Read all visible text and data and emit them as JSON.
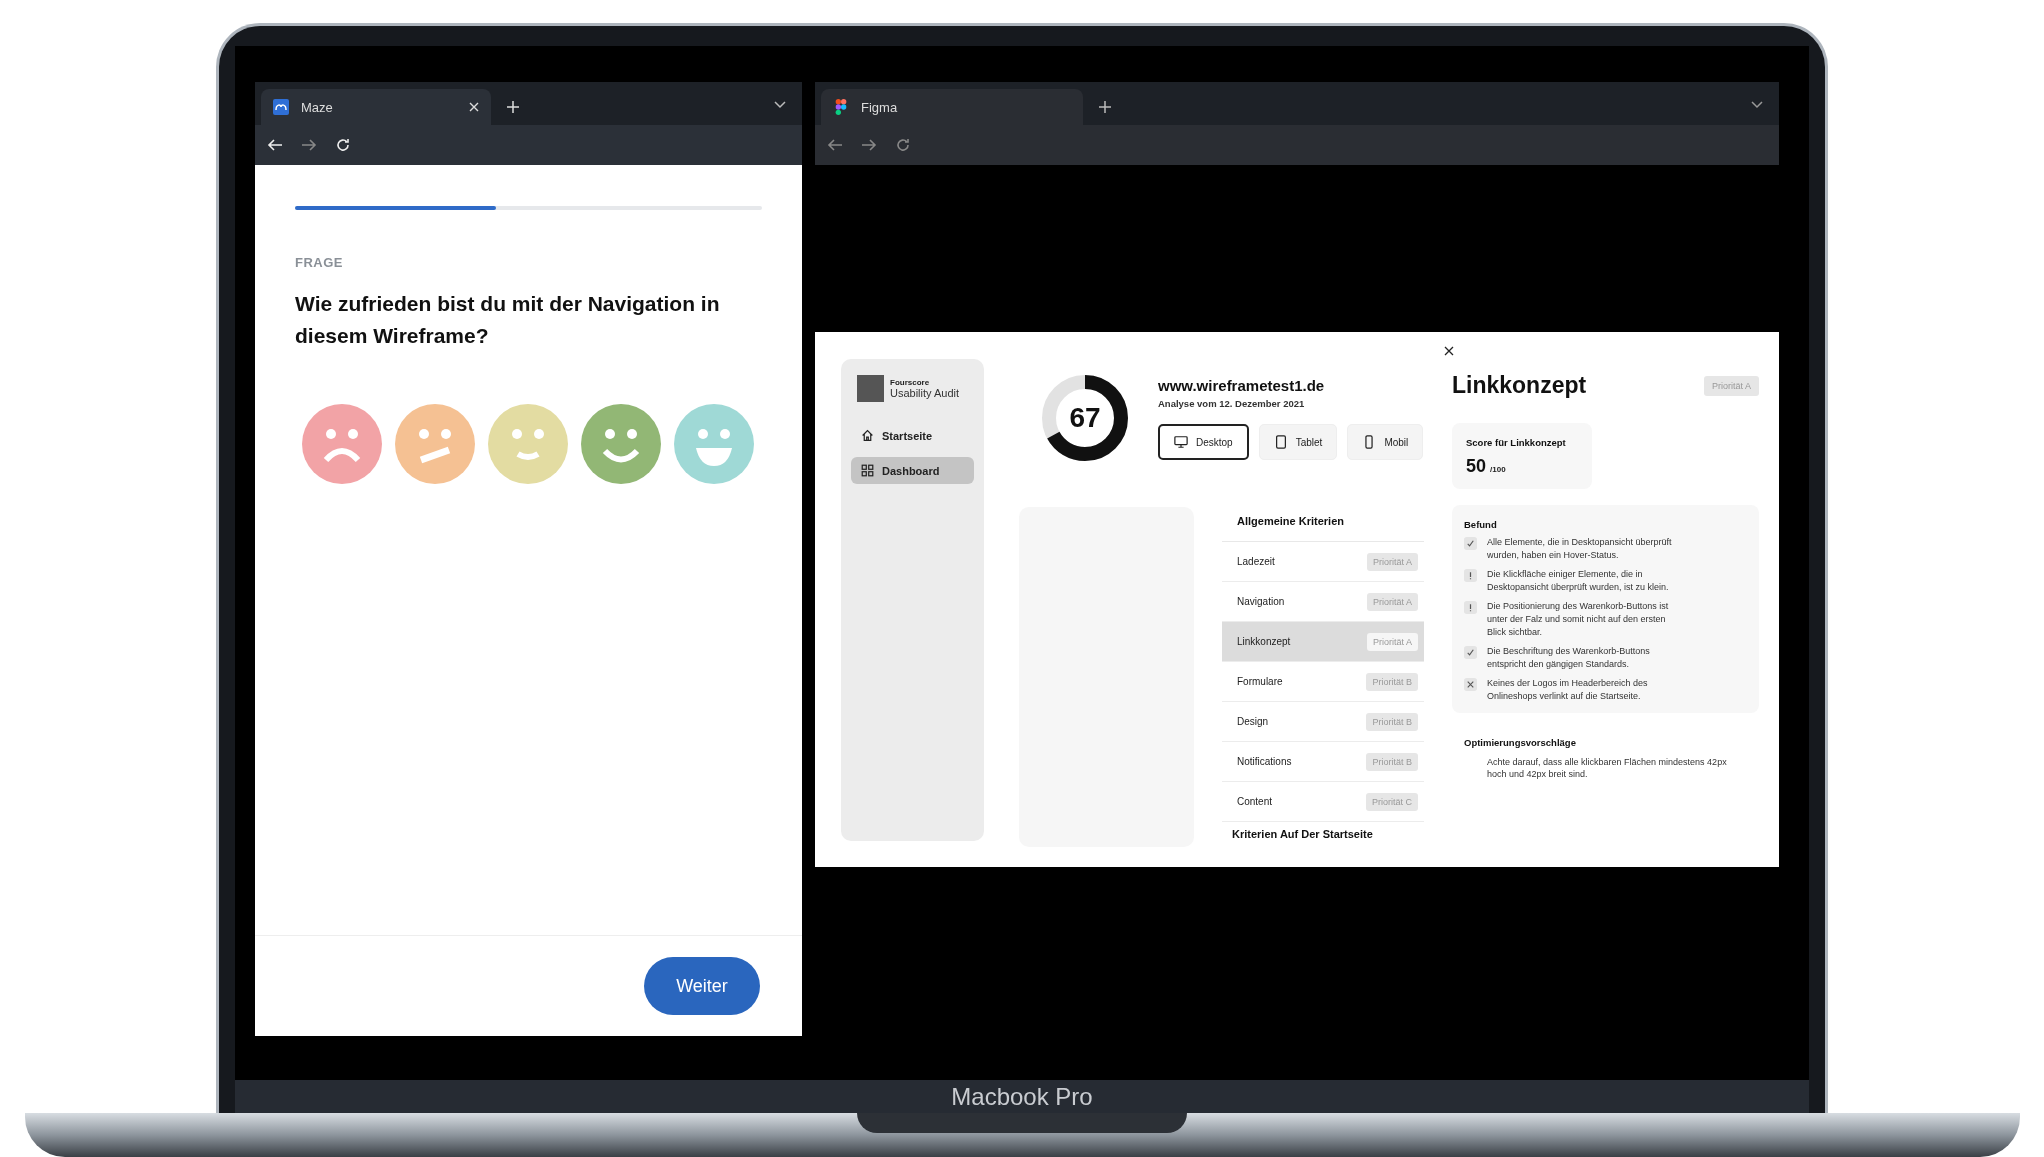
{
  "left_browser": {
    "tab": {
      "title": "Maze"
    },
    "survey": {
      "progress": {
        "level": 0.43
      },
      "label": "FRAGE",
      "question": "Wie zufrieden bist du mit der Navigation in diesem Wireframe?",
      "faces": [
        {
          "kind": "sad",
          "color": "#f2a3a6"
        },
        {
          "kind": "meh",
          "color": "#f5c193"
        },
        {
          "kind": "okay",
          "color": "#e3dca2"
        },
        {
          "kind": "happy",
          "color": "#92b775"
        },
        {
          "kind": "joyful",
          "color": "#9fd9d6"
        }
      ],
      "next_button": "Weiter"
    }
  },
  "right_browser": {
    "tab": {
      "title": "Figma"
    },
    "frame": {
      "sidebar": {
        "brand_small": "Fourscore",
        "brand": "Usability Audit",
        "items": [
          {
            "label": "Startseite",
            "kind": "home",
            "selected": false
          },
          {
            "label": "Dashboard",
            "kind": "grid",
            "selected": true
          }
        ]
      },
      "score": {
        "value": "67",
        "level": 0.67
      },
      "site": "www.wireframetest1.de",
      "date": "Analyse vom 12. Dezember 2021",
      "devices": [
        {
          "label": "Desktop",
          "kind": "desktop",
          "selected": true
        },
        {
          "label": "Tablet",
          "kind": "tablet",
          "selected": false
        },
        {
          "label": "Mobil",
          "kind": "phone",
          "selected": false
        }
      ],
      "criteria": {
        "title": "Allgemeine Kriterien",
        "rows": [
          {
            "name": "Ladezeit",
            "priority": "Priorität A",
            "selected": false
          },
          {
            "name": "Navigation",
            "priority": "Priorität A",
            "selected": false
          },
          {
            "name": "Linkkonzept",
            "priority": "Priorität A",
            "selected": true
          },
          {
            "name": "Formulare",
            "priority": "Priorität B",
            "selected": false
          },
          {
            "name": "Design",
            "priority": "Priorität B",
            "selected": false
          },
          {
            "name": "Notifications",
            "priority": "Priorität B",
            "selected": false
          },
          {
            "name": "Content",
            "priority": "Priorität C",
            "selected": false
          }
        ],
        "next_section": "Kriterien Auf Der Startseite"
      },
      "detail": {
        "title": "Linkkonzept",
        "priority": "Priorität A",
        "score_label": "Score für Linkkonzept",
        "score": "50",
        "score_max": "/100",
        "findings_title": "Befund",
        "findings": [
          {
            "kind": "check",
            "text": "Alle Elemente, die in Desktopansicht überprüft wurden, haben ein Hover-Status."
          },
          {
            "kind": "warn",
            "text": "Die Klickfläche einiger Elemente, die in Desktopansicht überprüft wurden, ist zu klein."
          },
          {
            "kind": "warn",
            "text": "Die Positionierung des Warenkorb-Buttons ist unter der Falz und somit nicht auf den ersten Blick sichtbar."
          },
          {
            "kind": "check",
            "text": "Die Beschriftung des Warenkorb-Buttons entspricht den gängigen Standards."
          },
          {
            "kind": "cross",
            "text": "Keines der Logos im Headerbereich des Onlineshops verlinkt auf die Startseite."
          }
        ],
        "suggestions_title": "Optimierungsvorschläge",
        "suggestion": "Achte darauf, dass alle klickbaren Flächen mindestens 42px hoch und 42px breit sind."
      }
    }
  },
  "device_label": "Macbook Pro"
}
